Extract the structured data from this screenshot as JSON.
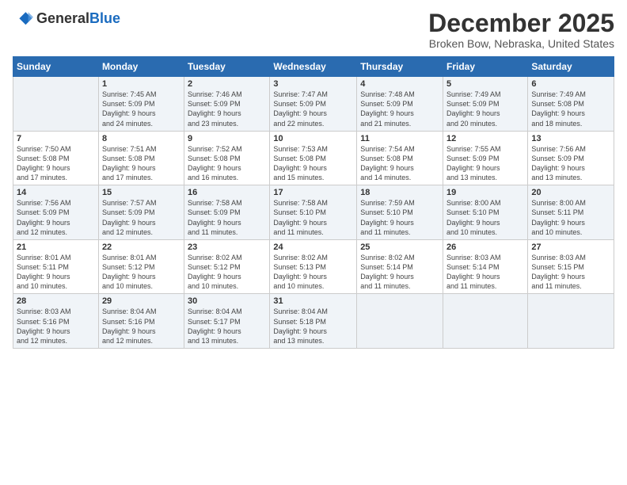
{
  "header": {
    "logo_line1": "General",
    "logo_line2": "Blue",
    "month": "December 2025",
    "location": "Broken Bow, Nebraska, United States"
  },
  "weekdays": [
    "Sunday",
    "Monday",
    "Tuesday",
    "Wednesday",
    "Thursday",
    "Friday",
    "Saturday"
  ],
  "weeks": [
    [
      {
        "day": "",
        "info": ""
      },
      {
        "day": "1",
        "info": "Sunrise: 7:45 AM\nSunset: 5:09 PM\nDaylight: 9 hours\nand 24 minutes."
      },
      {
        "day": "2",
        "info": "Sunrise: 7:46 AM\nSunset: 5:09 PM\nDaylight: 9 hours\nand 23 minutes."
      },
      {
        "day": "3",
        "info": "Sunrise: 7:47 AM\nSunset: 5:09 PM\nDaylight: 9 hours\nand 22 minutes."
      },
      {
        "day": "4",
        "info": "Sunrise: 7:48 AM\nSunset: 5:09 PM\nDaylight: 9 hours\nand 21 minutes."
      },
      {
        "day": "5",
        "info": "Sunrise: 7:49 AM\nSunset: 5:09 PM\nDaylight: 9 hours\nand 20 minutes."
      },
      {
        "day": "6",
        "info": "Sunrise: 7:49 AM\nSunset: 5:08 PM\nDaylight: 9 hours\nand 18 minutes."
      }
    ],
    [
      {
        "day": "7",
        "info": "Sunrise: 7:50 AM\nSunset: 5:08 PM\nDaylight: 9 hours\nand 17 minutes."
      },
      {
        "day": "8",
        "info": "Sunrise: 7:51 AM\nSunset: 5:08 PM\nDaylight: 9 hours\nand 17 minutes."
      },
      {
        "day": "9",
        "info": "Sunrise: 7:52 AM\nSunset: 5:08 PM\nDaylight: 9 hours\nand 16 minutes."
      },
      {
        "day": "10",
        "info": "Sunrise: 7:53 AM\nSunset: 5:08 PM\nDaylight: 9 hours\nand 15 minutes."
      },
      {
        "day": "11",
        "info": "Sunrise: 7:54 AM\nSunset: 5:08 PM\nDaylight: 9 hours\nand 14 minutes."
      },
      {
        "day": "12",
        "info": "Sunrise: 7:55 AM\nSunset: 5:09 PM\nDaylight: 9 hours\nand 13 minutes."
      },
      {
        "day": "13",
        "info": "Sunrise: 7:56 AM\nSunset: 5:09 PM\nDaylight: 9 hours\nand 13 minutes."
      }
    ],
    [
      {
        "day": "14",
        "info": "Sunrise: 7:56 AM\nSunset: 5:09 PM\nDaylight: 9 hours\nand 12 minutes."
      },
      {
        "day": "15",
        "info": "Sunrise: 7:57 AM\nSunset: 5:09 PM\nDaylight: 9 hours\nand 12 minutes."
      },
      {
        "day": "16",
        "info": "Sunrise: 7:58 AM\nSunset: 5:09 PM\nDaylight: 9 hours\nand 11 minutes."
      },
      {
        "day": "17",
        "info": "Sunrise: 7:58 AM\nSunset: 5:10 PM\nDaylight: 9 hours\nand 11 minutes."
      },
      {
        "day": "18",
        "info": "Sunrise: 7:59 AM\nSunset: 5:10 PM\nDaylight: 9 hours\nand 11 minutes."
      },
      {
        "day": "19",
        "info": "Sunrise: 8:00 AM\nSunset: 5:10 PM\nDaylight: 9 hours\nand 10 minutes."
      },
      {
        "day": "20",
        "info": "Sunrise: 8:00 AM\nSunset: 5:11 PM\nDaylight: 9 hours\nand 10 minutes."
      }
    ],
    [
      {
        "day": "21",
        "info": "Sunrise: 8:01 AM\nSunset: 5:11 PM\nDaylight: 9 hours\nand 10 minutes."
      },
      {
        "day": "22",
        "info": "Sunrise: 8:01 AM\nSunset: 5:12 PM\nDaylight: 9 hours\nand 10 minutes."
      },
      {
        "day": "23",
        "info": "Sunrise: 8:02 AM\nSunset: 5:12 PM\nDaylight: 9 hours\nand 10 minutes."
      },
      {
        "day": "24",
        "info": "Sunrise: 8:02 AM\nSunset: 5:13 PM\nDaylight: 9 hours\nand 10 minutes."
      },
      {
        "day": "25",
        "info": "Sunrise: 8:02 AM\nSunset: 5:14 PM\nDaylight: 9 hours\nand 11 minutes."
      },
      {
        "day": "26",
        "info": "Sunrise: 8:03 AM\nSunset: 5:14 PM\nDaylight: 9 hours\nand 11 minutes."
      },
      {
        "day": "27",
        "info": "Sunrise: 8:03 AM\nSunset: 5:15 PM\nDaylight: 9 hours\nand 11 minutes."
      }
    ],
    [
      {
        "day": "28",
        "info": "Sunrise: 8:03 AM\nSunset: 5:16 PM\nDaylight: 9 hours\nand 12 minutes."
      },
      {
        "day": "29",
        "info": "Sunrise: 8:04 AM\nSunset: 5:16 PM\nDaylight: 9 hours\nand 12 minutes."
      },
      {
        "day": "30",
        "info": "Sunrise: 8:04 AM\nSunset: 5:17 PM\nDaylight: 9 hours\nand 13 minutes."
      },
      {
        "day": "31",
        "info": "Sunrise: 8:04 AM\nSunset: 5:18 PM\nDaylight: 9 hours\nand 13 minutes."
      },
      {
        "day": "",
        "info": ""
      },
      {
        "day": "",
        "info": ""
      },
      {
        "day": "",
        "info": ""
      }
    ]
  ]
}
